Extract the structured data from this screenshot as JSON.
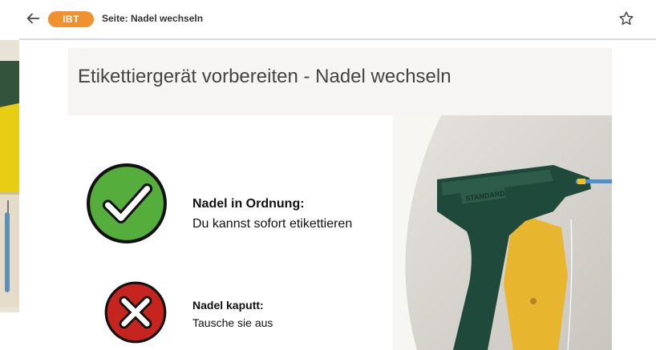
{
  "toolbar": {
    "badge": "IBT",
    "page_title": "Seite: Nadel wechseln"
  },
  "slide": {
    "title": "Etikettiergerät vorbereiten - Nadel wechseln",
    "ok": {
      "heading": "Nadel in Ordnung:",
      "text": "Du kannst sofort etikettieren"
    },
    "bad": {
      "heading": "Nadel kaputt:",
      "text": "Tausche sie aus"
    }
  },
  "photo": {
    "gun_brand": "STANDARD"
  },
  "colors": {
    "accent": "#f0902f",
    "ok_green": "#55ad3b",
    "bad_red": "#c6241e"
  },
  "icons": [
    "back-arrow-icon",
    "star-icon",
    "checkmark-icon",
    "x-mark-icon"
  ]
}
